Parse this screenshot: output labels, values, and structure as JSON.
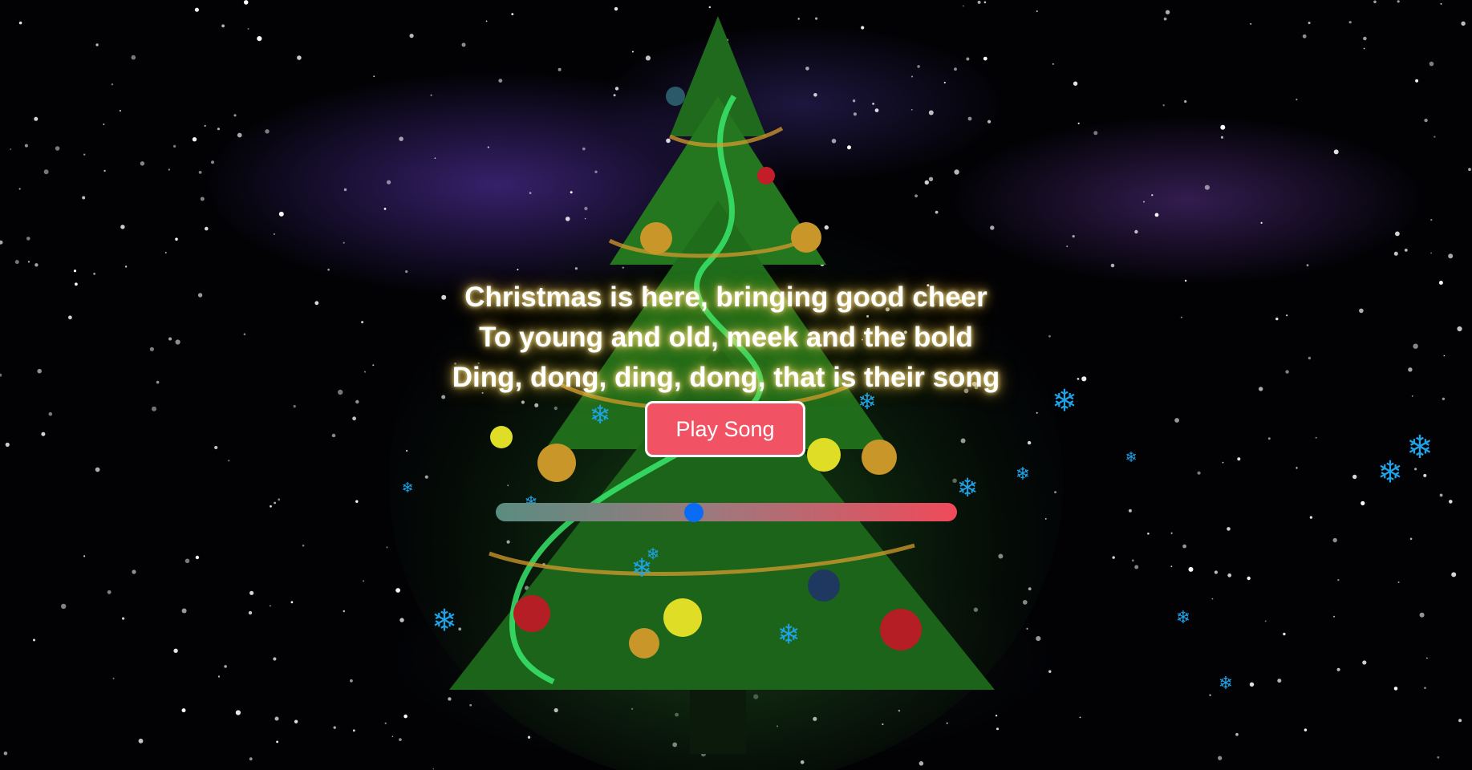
{
  "lyrics": {
    "lines": [
      "Christmas is here, bringing good cheer",
      "To young and old, meek and the bold",
      "Ding, dong, ding, dong, that is their song"
    ]
  },
  "controls": {
    "play_label": "Play Song",
    "volume_level": 0.43
  },
  "colors": {
    "button": "#f25364",
    "thumb": "#0a6cf5",
    "snowflake": "#1fa2e6",
    "lyric_glow": "#ffd75a"
  },
  "icons": {
    "snowflake": "snowflake-icon",
    "background": "christmas-tree-night-sky"
  }
}
